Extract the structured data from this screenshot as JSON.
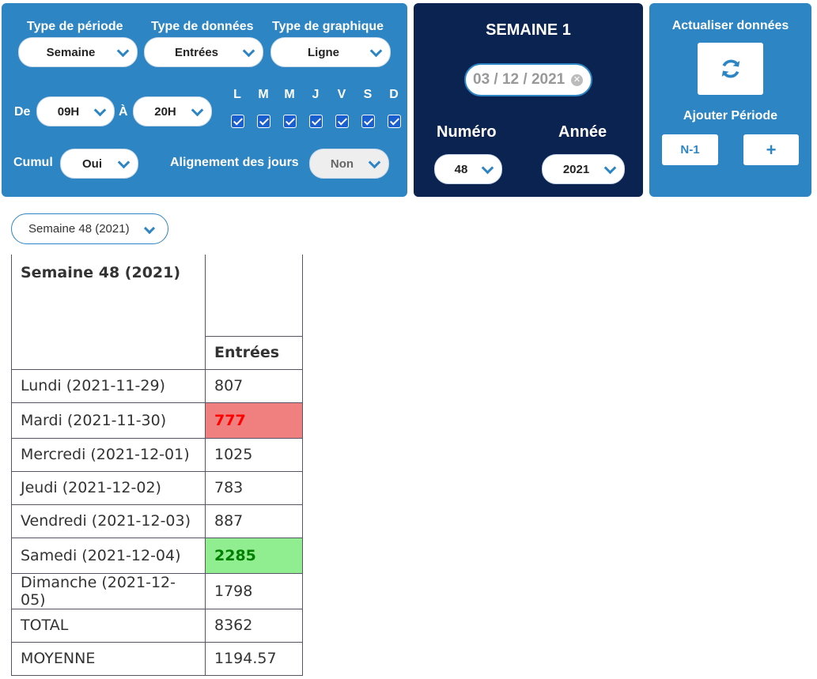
{
  "filters": {
    "period_type": {
      "label": "Type de période",
      "value": "Semaine"
    },
    "data_type": {
      "label": "Type de données",
      "value": "Entrées"
    },
    "chart_type": {
      "label": "Type de graphique",
      "value": "Ligne"
    },
    "from": {
      "label": "De",
      "value": "09H"
    },
    "to": {
      "label": "À",
      "value": "20H"
    },
    "days": [
      "L",
      "M",
      "M",
      "J",
      "V",
      "S",
      "D"
    ],
    "days_checked": [
      true,
      true,
      true,
      true,
      true,
      true,
      true
    ],
    "cumul": {
      "label": "Cumul",
      "value": "Oui"
    },
    "alignment": {
      "label": "Alignement des jours",
      "value": "Non"
    }
  },
  "week_panel": {
    "title": "SEMAINE 1",
    "date": "03 / 12 / 2021",
    "number": {
      "label": "Numéro",
      "value": "48"
    },
    "year": {
      "label": "Année",
      "value": "2021"
    }
  },
  "actions": {
    "refresh_label": "Actualiser données",
    "add_period_label": "Ajouter Période",
    "n1_label": "N-1",
    "plus_label": "+"
  },
  "period_select": "Semaine 48 (2021)",
  "table": {
    "title": "Semaine 48 (2021)",
    "column": "Entrées",
    "rows": [
      {
        "label": "Lundi (2021-11-29)",
        "value": "807",
        "highlight": ""
      },
      {
        "label": "Mardi (2021-11-30)",
        "value": "777",
        "highlight": "low"
      },
      {
        "label": "Mercredi (2021-12-01)",
        "value": "1025",
        "highlight": ""
      },
      {
        "label": "Jeudi (2021-12-02)",
        "value": "783",
        "highlight": ""
      },
      {
        "label": "Vendredi (2021-12-03)",
        "value": "887",
        "highlight": ""
      },
      {
        "label": "Samedi (2021-12-04)",
        "value": "2285",
        "highlight": "high"
      },
      {
        "label": "Dimanche (2021-12-05)",
        "value": "1798",
        "highlight": ""
      },
      {
        "label": "TOTAL",
        "value": "8362",
        "highlight": ""
      },
      {
        "label": "MOYENNE",
        "value": "1194.57",
        "highlight": ""
      }
    ]
  },
  "colors": {
    "panel_blue": "#2e85c3",
    "panel_navy": "#0b2350",
    "low": "#f08080",
    "high": "#90ee90"
  }
}
